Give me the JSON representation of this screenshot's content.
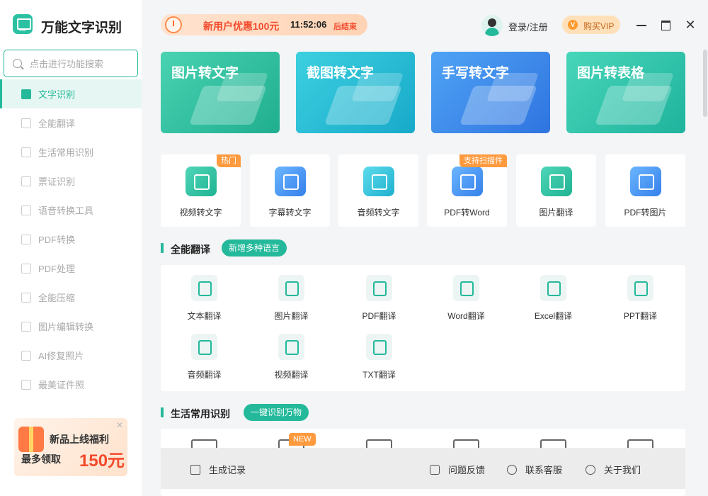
{
  "app": {
    "title": "万能文字识别"
  },
  "search": {
    "placeholder": "点击进行功能搜索"
  },
  "sidebar": {
    "items": [
      {
        "label": "文字识别",
        "icon": "ocr-icon",
        "active": true
      },
      {
        "label": "全能翻译",
        "icon": "translate-icon"
      },
      {
        "label": "生活常用识别",
        "icon": "scan-icon"
      },
      {
        "label": "票证识别",
        "icon": "ticket-icon"
      },
      {
        "label": "语音转换工具",
        "icon": "voice-icon"
      },
      {
        "label": "PDF转换",
        "icon": "pdf-icon"
      },
      {
        "label": "PDF处理",
        "icon": "pdf-process-icon"
      },
      {
        "label": "全能压缩",
        "icon": "compress-icon"
      },
      {
        "label": "图片编辑转换",
        "icon": "image-edit-icon"
      },
      {
        "label": "AI修复照片",
        "icon": "ai-repair-icon"
      },
      {
        "label": "最美证件照",
        "icon": "id-photo-icon"
      }
    ]
  },
  "promo": {
    "line1": "新品上线福利",
    "line2": "最多领取",
    "amount": "150元"
  },
  "top_banner": {
    "offer": "新用户优惠100元",
    "timer": "11:52:06",
    "ending": "后结束"
  },
  "header": {
    "login": "登录/注册",
    "vip_badge": "V",
    "vip": "购买VIP"
  },
  "big_cards": [
    {
      "title": "图片转文字",
      "color": "#2cc1a3"
    },
    {
      "title": "截图转文字",
      "color": "#21b5d4"
    },
    {
      "title": "手写转文字",
      "color": "#3a86e8"
    },
    {
      "title": "图片转表格",
      "color": "#2bbfa6"
    }
  ],
  "tools": [
    {
      "label": "视频转文字",
      "badge": "热门",
      "icon": "video-text-icon"
    },
    {
      "label": "字幕转文字",
      "icon": "subtitle-icon"
    },
    {
      "label": "音频转文字",
      "icon": "audio-text-icon"
    },
    {
      "label": "PDF转Word",
      "badge": "支持扫描件",
      "icon": "pdf-word-icon"
    },
    {
      "label": "图片翻译",
      "icon": "image-translate-icon"
    },
    {
      "label": "PDF转图片",
      "icon": "pdf-image-icon"
    }
  ],
  "section_translate": {
    "title": "全能翻译",
    "tag": "新增多种语言"
  },
  "translate_items": [
    {
      "label": "文本翻译",
      "icon": "text-translate-icon"
    },
    {
      "label": "图片翻译",
      "icon": "image-translate-icon"
    },
    {
      "label": "PDF翻译",
      "icon": "pdf-translate-icon"
    },
    {
      "label": "Word翻译",
      "icon": "word-translate-icon"
    },
    {
      "label": "Excel翻译",
      "icon": "excel-translate-icon"
    },
    {
      "label": "PPT翻译",
      "icon": "ppt-translate-icon"
    },
    {
      "label": "音频翻译",
      "icon": "audio-translate-icon"
    },
    {
      "label": "视频翻译",
      "icon": "video-translate-icon"
    },
    {
      "label": "TXT翻译",
      "icon": "txt-translate-icon"
    }
  ],
  "section_life": {
    "title": "生活常用识别",
    "tag": "一键识别万物",
    "new_badge": "NEW"
  },
  "bottom": {
    "history": "生成记录",
    "feedback": "问题反馈",
    "support": "联系客服",
    "about": "关于我们"
  },
  "colors": {
    "accent": "#23b99a",
    "promo_red": "#f24a2c",
    "badge_orange": "#ff9a3e"
  }
}
